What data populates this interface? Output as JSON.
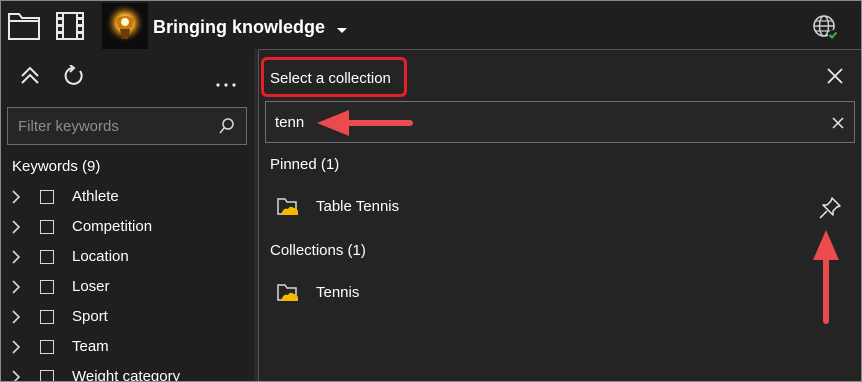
{
  "app": {
    "title": "Bringing knowledge"
  },
  "icons": {
    "folder": "folder-icon",
    "film": "film-strip-icon",
    "logo": "app-logo-icon",
    "caret": "chevron-down-icon",
    "globe": "globe-check-icon",
    "collapse": "collapse-all-icon",
    "refresh": "refresh-icon",
    "more": "more-options-icon",
    "search": "search-icon",
    "close": "close-icon",
    "clear": "clear-icon",
    "pin": "pin-icon",
    "collection": "collection-folder-icon"
  },
  "keywords_panel": {
    "filter_placeholder": "Filter keywords",
    "heading": "Keywords (9)",
    "items": [
      {
        "label": "Athlete"
      },
      {
        "label": "Competition"
      },
      {
        "label": "Location"
      },
      {
        "label": "Loser"
      },
      {
        "label": "Sport"
      },
      {
        "label": "Team"
      },
      {
        "label": "Weight category"
      }
    ]
  },
  "collection_picker": {
    "title": "Select a collection",
    "search_value": "tenn",
    "pinned_heading": "Pinned (1)",
    "pinned": [
      {
        "label": "Table Tennis"
      }
    ],
    "collections_heading": "Collections (1)",
    "collections": [
      {
        "label": "Tennis"
      }
    ]
  },
  "colors": {
    "background": "#1f1f1f",
    "panel": "#242424",
    "highlight_red": "#e5202a",
    "arrow_red": "#ec4b4e",
    "check_green": "#3bb54a",
    "folder_yellow": "#f5b800"
  }
}
